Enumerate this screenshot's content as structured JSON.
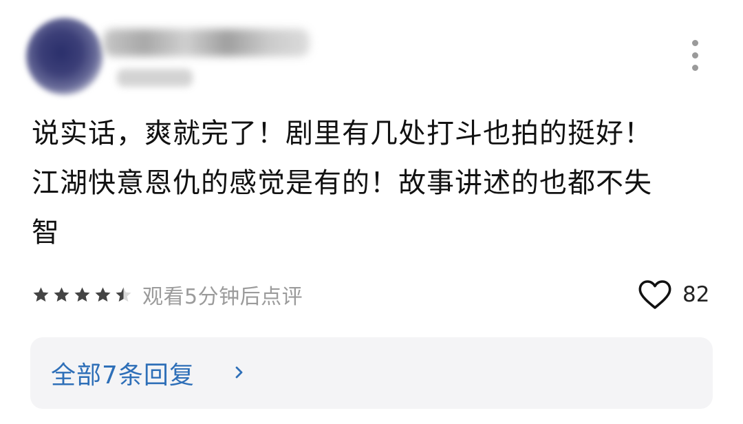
{
  "comment": {
    "text_lines": [
      "说实话，爽就完了！剧里有几处打斗也拍的挺好！",
      "江湖快意恩仇的感觉是有的！故事讲述的也都不失",
      "智"
    ],
    "rating": 4.5,
    "rating_max": 5,
    "watch_note": "观看5分钟后点评",
    "likes": "82",
    "replies_label": "全部7条回复"
  },
  "icons": {
    "more": "more-vertical-icon",
    "star": "star-icon",
    "half_star": "star-half-icon",
    "like": "heart-outline-icon",
    "chevron": "chevron-right-icon"
  },
  "colors": {
    "text": "#111111",
    "muted": "#9b9b9b",
    "star": "#444444",
    "link": "#2e6fb8",
    "replies_bg": "#f4f4f6"
  }
}
